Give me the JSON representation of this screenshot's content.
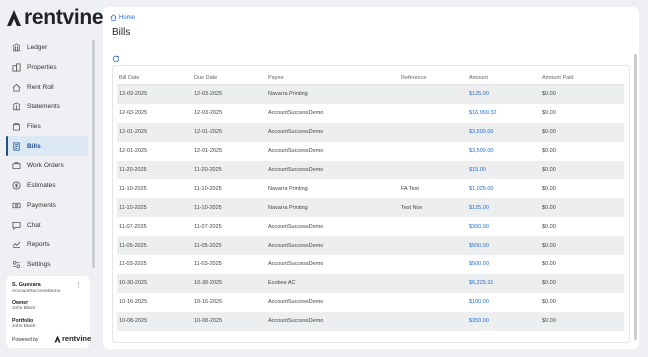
{
  "brand": {
    "name": "rentvine"
  },
  "sidebar": {
    "items": [
      {
        "label": "Ledger",
        "icon": "ledger-icon",
        "active": false
      },
      {
        "label": "Properties",
        "icon": "properties-icon",
        "active": false
      },
      {
        "label": "Rent Roll",
        "icon": "rent-roll-icon",
        "active": false
      },
      {
        "label": "Statements",
        "icon": "statements-icon",
        "active": false
      },
      {
        "label": "Files",
        "icon": "files-icon",
        "active": false
      },
      {
        "label": "Bills",
        "icon": "bills-icon",
        "active": true
      },
      {
        "label": "Work Orders",
        "icon": "work-orders-icon",
        "active": false
      },
      {
        "label": "Estimates",
        "icon": "estimates-icon",
        "active": false
      },
      {
        "label": "Payments",
        "icon": "payments-icon",
        "active": false
      },
      {
        "label": "Chat",
        "icon": "chat-icon",
        "active": false
      },
      {
        "label": "Reports",
        "icon": "reports-icon",
        "active": false
      },
      {
        "label": "Settings",
        "icon": "settings-icon",
        "active": false
      }
    ]
  },
  "user": {
    "name": "S. Guevara",
    "account": "AccountSuccessDemo",
    "owner_label": "Owner",
    "owner_value": "John Black",
    "portfolio_label": "Portfolio",
    "portfolio_value": "John Black",
    "powered_by": "Powered by",
    "powered_brand": "rentvine"
  },
  "breadcrumb": {
    "home": "Home"
  },
  "page": {
    "title": "Bills"
  },
  "table": {
    "columns": [
      "Bill Date",
      "Due Date",
      "Payee",
      "Reference",
      "Amount",
      "Amount Paid"
    ],
    "rows": [
      [
        "12-03-2025",
        "12-03-2025",
        "Navarra Printing",
        "",
        "$125.00",
        "$0.00"
      ],
      [
        "12-03-2025",
        "12-03-2025",
        "AccountSuccessDemo",
        "",
        "$16,969.32",
        "$0.00"
      ],
      [
        "12-01-2025",
        "12-01-2025",
        "AccountSuccessDemo",
        "",
        "$3,500.00",
        "$0.00"
      ],
      [
        "12-01-2025",
        "12-01-2025",
        "AccountSuccessDemo",
        "",
        "$3,500.00",
        "$0.00"
      ],
      [
        "11-20-2025",
        "11-20-2025",
        "AccountSuccessDemo",
        "",
        "$15.00",
        "$0.00"
      ],
      [
        "11-10-2025",
        "11-10-2025",
        "Navarra Printing",
        "FA Test",
        "$1,025.00",
        "$0.00"
      ],
      [
        "11-10-2025",
        "11-10-2025",
        "Navarra Printing",
        "Test Nov",
        "$125.00",
        "$0.00"
      ],
      [
        "11-07-2025",
        "11-07-2025",
        "AccountSuccessDemo",
        "",
        "$300.00",
        "$0.00"
      ],
      [
        "11-05-2025",
        "11-05-2025",
        "AccountSuccessDemo",
        "",
        "$500.00",
        "$0.00"
      ],
      [
        "11-03-2025",
        "11-03-2025",
        "AccountSuccessDemo",
        "",
        "$500.00",
        "$0.00"
      ],
      [
        "10-30-2025",
        "10-30-2025",
        "Ecobee AC",
        "",
        "$6,225.31",
        "$0.00"
      ],
      [
        "10-16-2025",
        "10-16-2025",
        "AccountSuccessDemo",
        "",
        "$100.00",
        "$0.00"
      ],
      [
        "10-08-2025",
        "10-08-2025",
        "AccountSuccessDemo",
        "",
        "$350.00",
        "$0.00"
      ]
    ]
  },
  "colors": {
    "accent": "#1d6fd6",
    "active_nav": "#1d4f91",
    "active_bg": "#dde8f5"
  }
}
